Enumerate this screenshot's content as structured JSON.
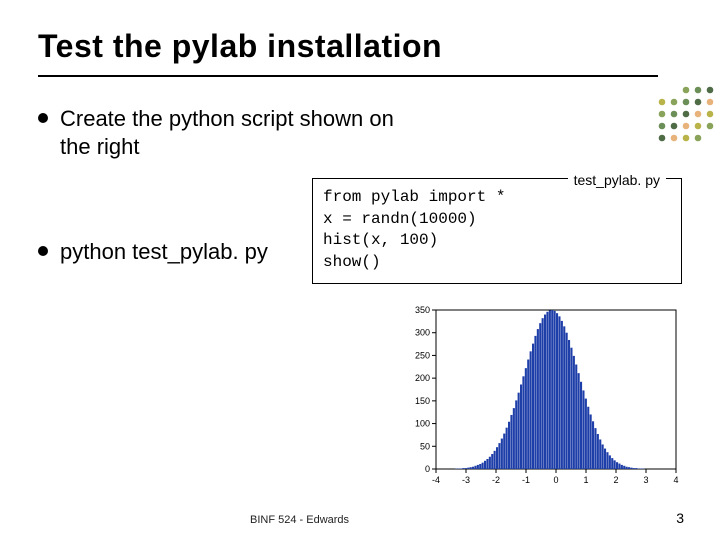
{
  "title": "Test the pylab installation",
  "bullets": [
    "Create the python script shown on the right",
    "python test_pylab. py"
  ],
  "code": {
    "legend": "test_pylab. py",
    "lines": [
      "from pylab import *",
      "x = randn(10000)",
      "hist(x, 100)",
      "show()"
    ]
  },
  "footer": {
    "center": "BINF 524 - Edwards",
    "page": "3"
  },
  "chart_data": {
    "type": "bar",
    "title": "",
    "xlabel": "",
    "ylabel": "",
    "x_ticks": [
      -4,
      -3,
      -2,
      -1,
      0,
      1,
      2,
      3,
      4
    ],
    "y_ticks": [
      0,
      50,
      100,
      150,
      200,
      250,
      300,
      350
    ],
    "xlim": [
      -4,
      4
    ],
    "ylim": [
      0,
      350
    ],
    "categories_note": "100 uniform bins on [-4,4] approximating a standard normal histogram of 10000 samples",
    "bar_color": "#1e3ea8",
    "series": [
      {
        "name": "hist",
        "x_start": -4,
        "x_end": 4,
        "n_bins": 100,
        "values": [
          0,
          0,
          0,
          0,
          0,
          0,
          0,
          0,
          1,
          1,
          1,
          2,
          2,
          3,
          4,
          5,
          7,
          9,
          11,
          14,
          18,
          22,
          27,
          33,
          40,
          48,
          57,
          67,
          78,
          91,
          104,
          119,
          134,
          151,
          168,
          186,
          204,
          222,
          241,
          259,
          276,
          293,
          308,
          321,
          332,
          340,
          346,
          349,
          350,
          348,
          343,
          336,
          326,
          314,
          300,
          284,
          267,
          249,
          230,
          211,
          192,
          173,
          155,
          137,
          120,
          105,
          90,
          77,
          65,
          54,
          45,
          37,
          30,
          24,
          19,
          15,
          12,
          9,
          7,
          5,
          4,
          3,
          2,
          2,
          1,
          1,
          1,
          0,
          0,
          0,
          0,
          0,
          0,
          0,
          0,
          0,
          0,
          0,
          0,
          0
        ]
      }
    ]
  },
  "decor_colors": [
    "#e8b37b",
    "#b9b44a",
    "#8aa35a",
    "#6c8f58",
    "#4f6c47"
  ]
}
